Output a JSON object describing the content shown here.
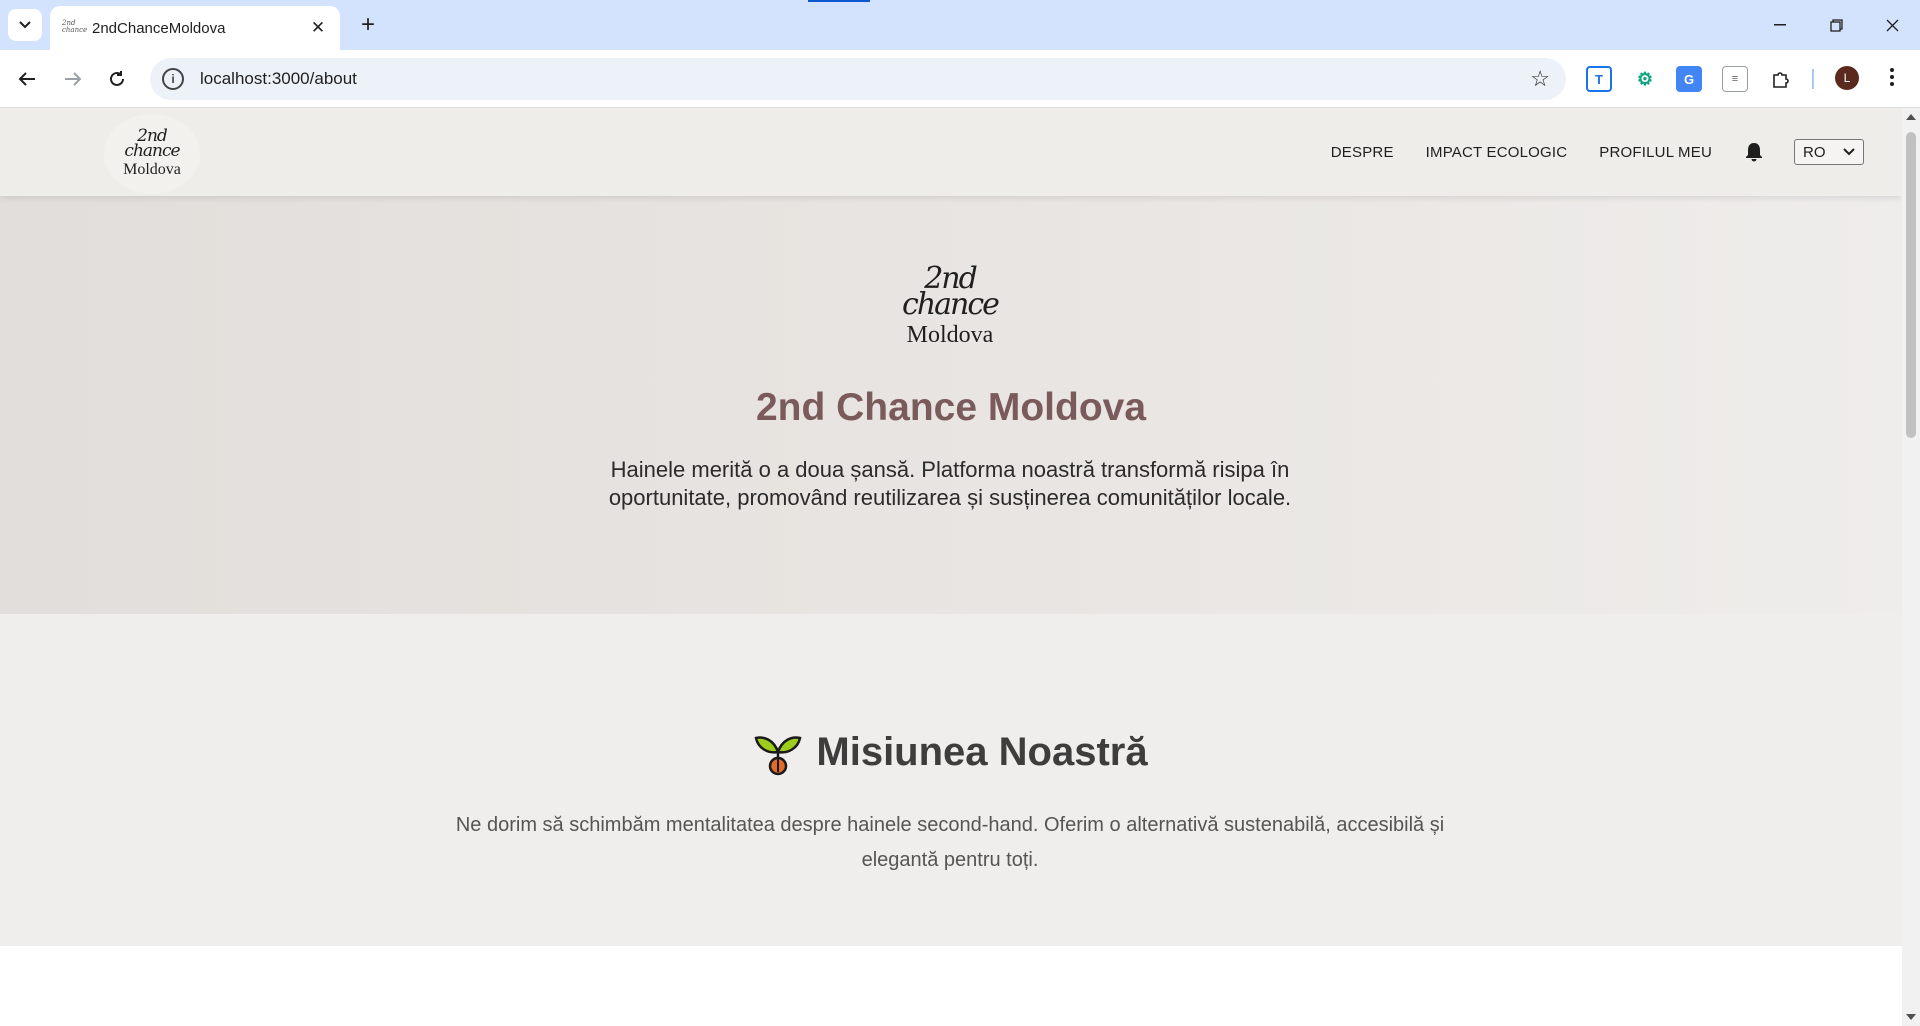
{
  "browser": {
    "tab_title": "2ndChanceMoldova",
    "tab_favicon_text": "2nd chance",
    "url": "localhost:3000/about",
    "profile_initial": "L"
  },
  "header": {
    "logo": {
      "line1": "2nd",
      "line2": "chance",
      "line3": "Moldova"
    },
    "nav": [
      {
        "label": "DESPRE"
      },
      {
        "label": "IMPACT ECOLOGIC"
      },
      {
        "label": "PROFILUL MEU"
      }
    ],
    "notification_icon": "bell-icon",
    "language": {
      "selected": "RO"
    }
  },
  "hero": {
    "logo": {
      "line1": "2nd",
      "line2": "chance",
      "line3": "Moldova"
    },
    "title": "2nd Chance Moldova",
    "description": "Hainele merită o a doua șansă. Platforma noastră transformă risipa în oportunitate, promovând reutilizarea și susținerea comunităților locale."
  },
  "mission": {
    "icon": "seedling-icon",
    "title": "Misiunea Noastră",
    "text": "Ne dorim să schimbăm mentalitatea despre hainele second-hand. Oferim o alternativă sustenabilă, accesibilă și elegantă pentru toți."
  },
  "colors": {
    "brand_title": "#7a5a5a",
    "header_bg": "#efedea",
    "chrome_tabbar": "#d3e3fd"
  }
}
